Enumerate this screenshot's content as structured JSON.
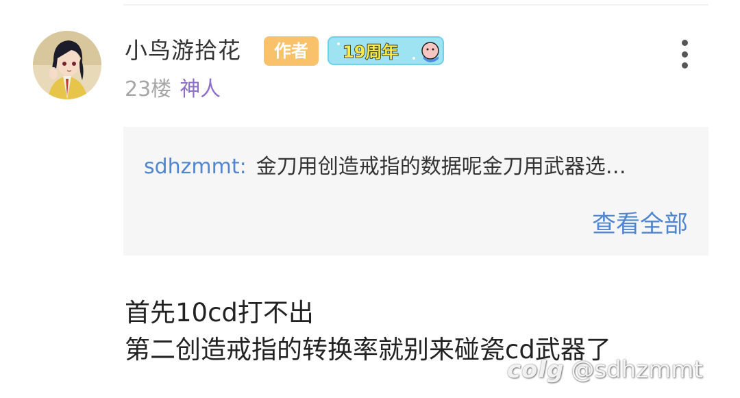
{
  "post": {
    "username": "小鸟游拾花",
    "author_badge": "作者",
    "anniversary_badge": "19周年",
    "floor": "23楼",
    "user_title": "神人",
    "quote": {
      "user": "sdhzmmt:",
      "text": "金刀用创造戒指的数据呢金刀用武器选…",
      "view_all": "查看全部"
    },
    "body_lines": [
      "首先10cd打不出",
      "第二创造戒指的转换率就别来碰瓷cd武器了"
    ]
  },
  "watermark": {
    "logo": "colg",
    "handle": "@sdhzmmt"
  },
  "colors": {
    "link_blue": "#4f86cf",
    "title_purple": "#8e6fc7",
    "author_badge": "#f8c16a"
  },
  "icons": {
    "more": "more-vertical-icon",
    "avatar": "user-avatar"
  }
}
